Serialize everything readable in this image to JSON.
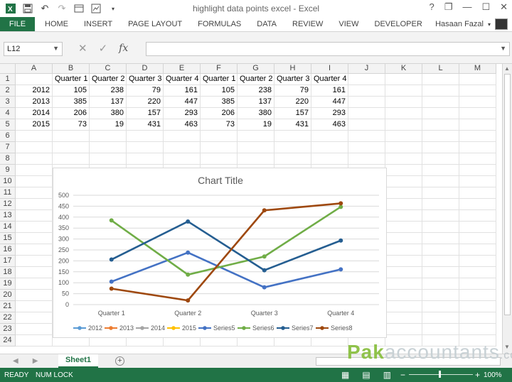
{
  "window": {
    "title": "highlight data points excel - Excel",
    "help": "?",
    "restore": "❐",
    "minimize": "—",
    "maximize": "☐",
    "close": "✕"
  },
  "qat": {
    "save_icon": "save-icon",
    "undo_icon": "undo-icon",
    "redo_icon": "redo-icon"
  },
  "ribbon": {
    "file": "FILE",
    "tabs": [
      "HOME",
      "INSERT",
      "PAGE LAYOUT",
      "FORMULAS",
      "DATA",
      "REVIEW",
      "VIEW",
      "DEVELOPER"
    ],
    "user": "Hasaan Fazal"
  },
  "formula_bar": {
    "name_box": "L12",
    "fx": "fx",
    "cancel": "✕",
    "enter": "✓",
    "formula": ""
  },
  "grid": {
    "columns": [
      "A",
      "B",
      "C",
      "D",
      "E",
      "F",
      "G",
      "H",
      "I",
      "J",
      "K",
      "L",
      "M"
    ],
    "rows": [
      "1",
      "2",
      "3",
      "4",
      "5",
      "6",
      "7",
      "8",
      "9",
      "10",
      "11",
      "12",
      "13",
      "14",
      "15",
      "16",
      "17",
      "18",
      "19",
      "20",
      "21",
      "22",
      "23",
      "24"
    ],
    "header_row": [
      "",
      "Quarter 1",
      "Quarter 2",
      "Quarter 3",
      "Quarter 4",
      "Quarter 1",
      "Quarter 2",
      "Quarter 3",
      "Quarter 4"
    ],
    "data_rows": [
      [
        "2012",
        "105",
        "238",
        "79",
        "161",
        "105",
        "238",
        "79",
        "161"
      ],
      [
        "2013",
        "385",
        "137",
        "220",
        "447",
        "385",
        "137",
        "220",
        "447"
      ],
      [
        "2014",
        "206",
        "380",
        "157",
        "293",
        "206",
        "380",
        "157",
        "293"
      ],
      [
        "2015",
        "73",
        "19",
        "431",
        "463",
        "73",
        "19",
        "431",
        "463"
      ]
    ]
  },
  "chart_data": {
    "type": "line",
    "title": "Chart Title",
    "categories": [
      "Quarter 1",
      "Quarter 2",
      "Quarter 3",
      "Quarter 4"
    ],
    "ylim": [
      0,
      500
    ],
    "yticks": [
      0,
      50,
      100,
      150,
      200,
      250,
      300,
      350,
      400,
      450,
      500
    ],
    "legend_position": "bottom",
    "grid": true,
    "series": [
      {
        "name": "2012",
        "values": [
          105,
          238,
          79,
          161
        ],
        "color": "#5b9bd5",
        "visible": false
      },
      {
        "name": "2013",
        "values": [
          385,
          137,
          220,
          447
        ],
        "color": "#ed7d31",
        "visible": false
      },
      {
        "name": "2014",
        "values": [
          206,
          380,
          157,
          293
        ],
        "color": "#a5a5a5",
        "visible": false
      },
      {
        "name": "2015",
        "values": [
          73,
          19,
          431,
          463
        ],
        "color": "#ffc000",
        "visible": false
      },
      {
        "name": "Series5",
        "values": [
          105,
          238,
          79,
          161
        ],
        "color": "#4472c4",
        "visible": true
      },
      {
        "name": "Series6",
        "values": [
          385,
          137,
          220,
          447
        ],
        "color": "#70ad47",
        "visible": true
      },
      {
        "name": "Series7",
        "values": [
          206,
          380,
          157,
          293
        ],
        "color": "#255e91",
        "visible": true
      },
      {
        "name": "Series8",
        "values": [
          73,
          19,
          431,
          463
        ],
        "color": "#9e480e",
        "visible": true
      }
    ]
  },
  "sheets": {
    "active": "Sheet1",
    "add": "+"
  },
  "watermark": {
    "brand": "Pak",
    "rest": "accountants",
    "suffix": ".com"
  },
  "status": {
    "ready": "READY",
    "numlock": "NUM LOCK",
    "zoom": "100%",
    "zoom_minus": "−",
    "zoom_plus": "+"
  },
  "colors": {
    "excel_green": "#217346"
  }
}
